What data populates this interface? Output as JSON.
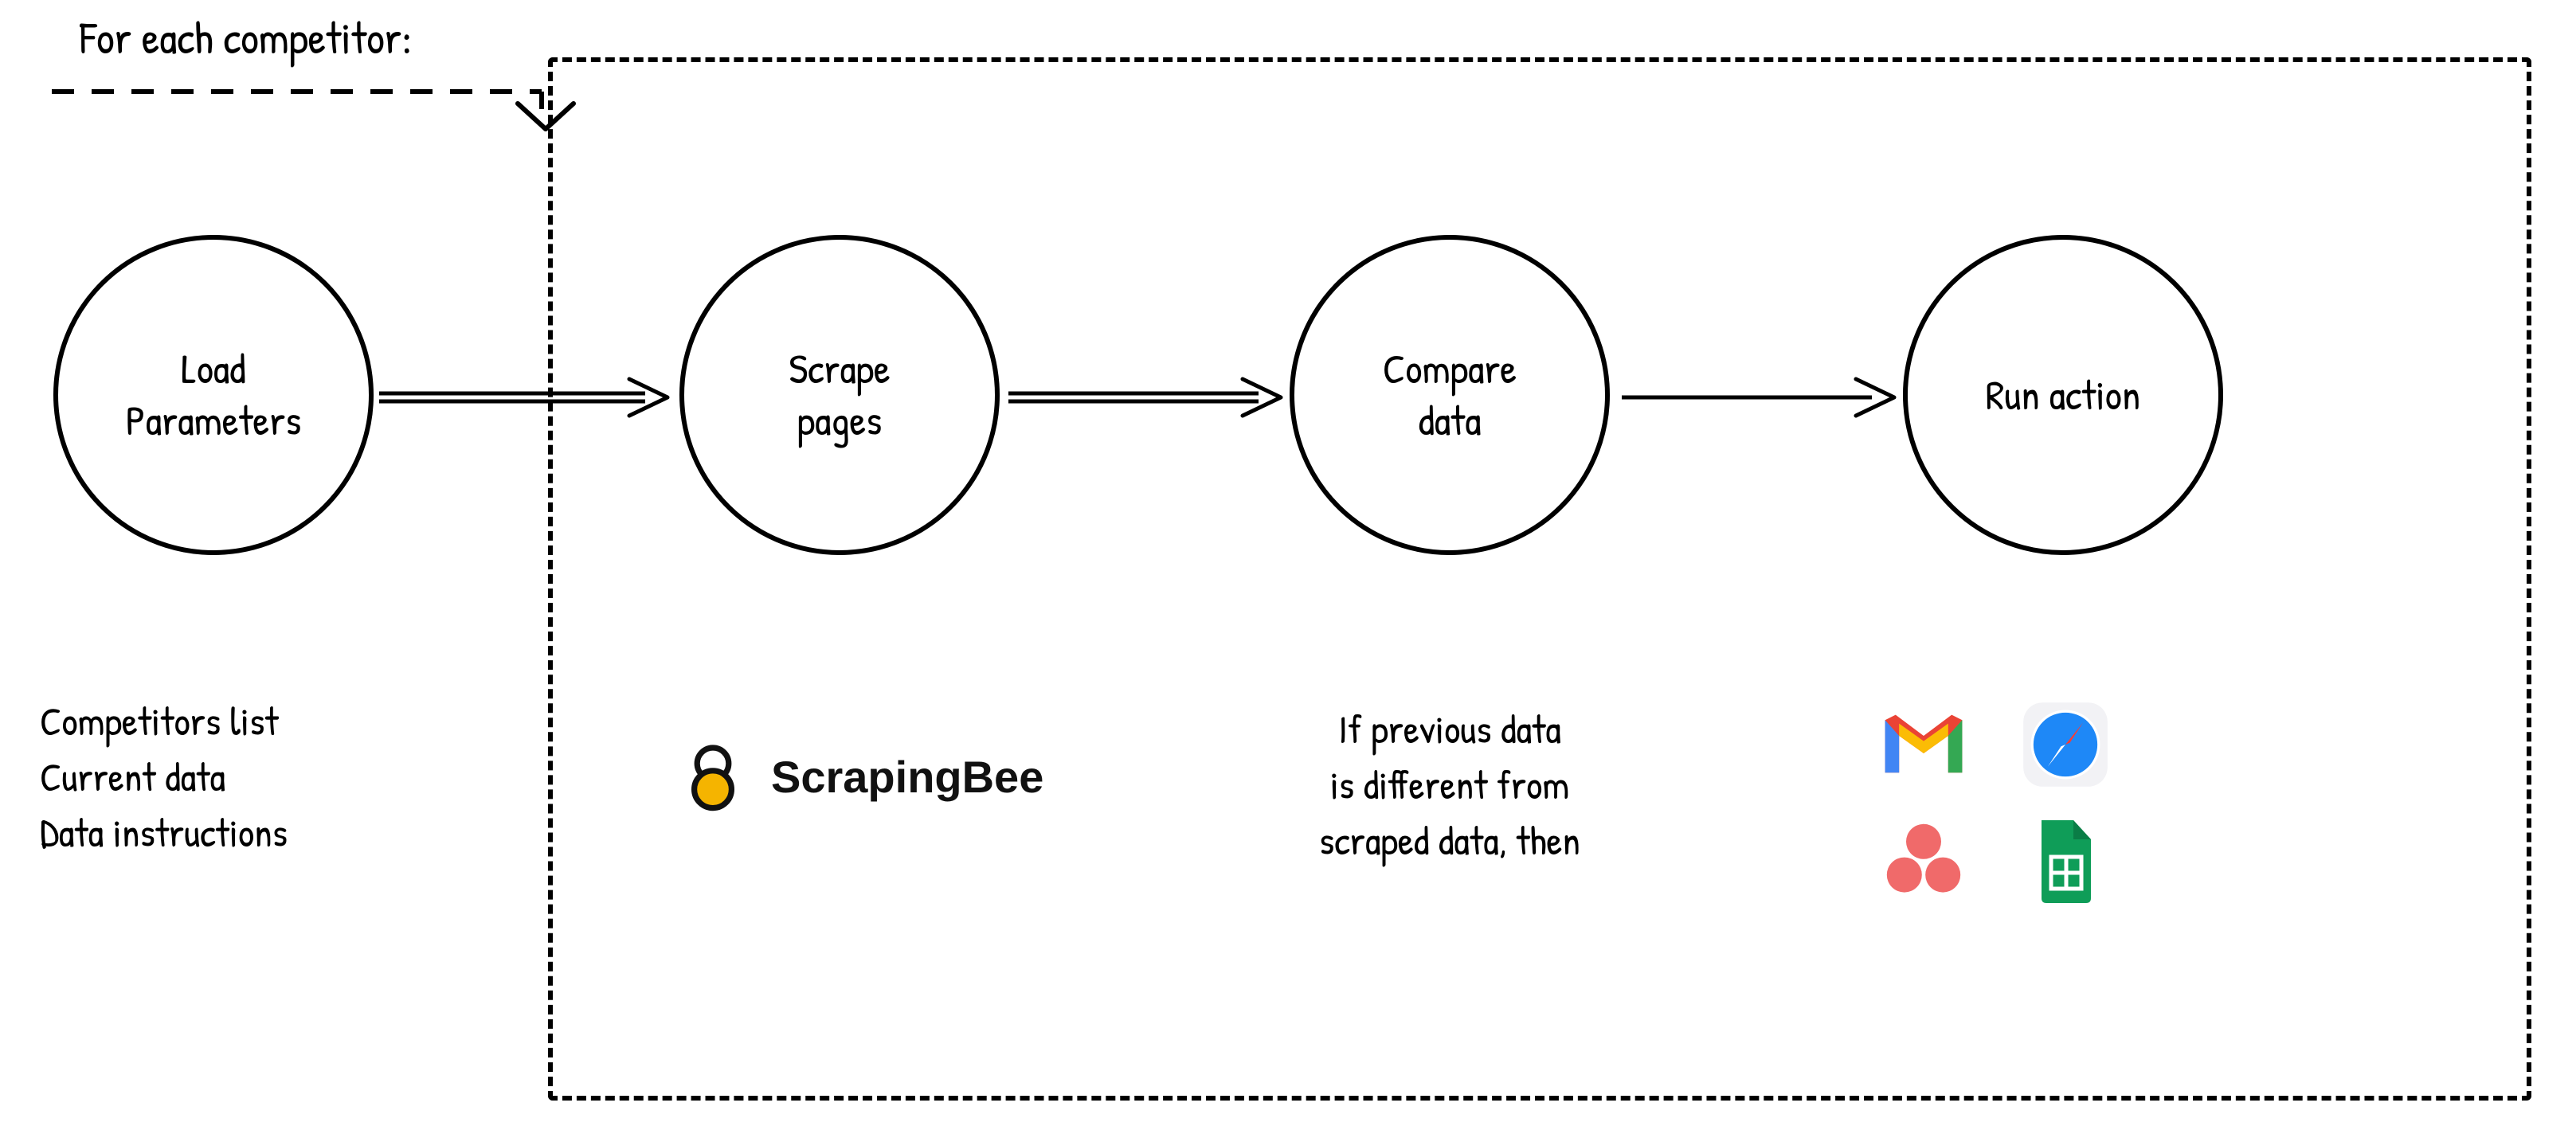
{
  "loop": {
    "label": "For each competitor:"
  },
  "nodes": {
    "load": {
      "label": "Load\nParameters"
    },
    "scrape": {
      "label": "Scrape\npages"
    },
    "compare": {
      "label": "Compare\ndata"
    },
    "action": {
      "label": "Run action"
    }
  },
  "captions": {
    "load": "Competitors list\nCurrent data\nData instructions",
    "compare": "If previous data\nis different from\nscraped data, then"
  },
  "scrapingbee": {
    "label": "ScrapingBee"
  },
  "icons": {
    "gmail": "gmail-icon",
    "safari": "safari-icon",
    "asana": "asana-icon",
    "sheets": "google-sheets-icon"
  }
}
